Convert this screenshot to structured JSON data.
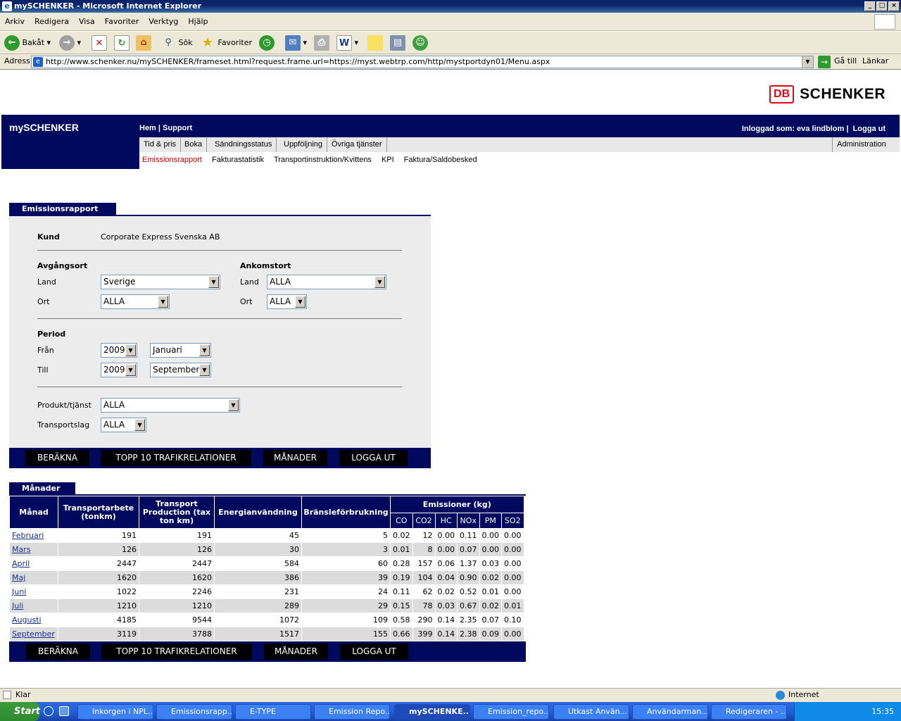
{
  "window": {
    "title": "mySCHENKER - Microsoft Internet Explorer"
  },
  "menu": [
    "Arkiv",
    "Redigera",
    "Visa",
    "Favoriter",
    "Verktyg",
    "Hjälp"
  ],
  "toolbar": {
    "back": "Bakåt",
    "search": "Sök",
    "favorites": "Favoriter"
  },
  "address": {
    "label": "Adress",
    "url": "http://www.schenker.nu/mySCHENKER/frameset.html?request.frame.url=https://myst.webtrp.com/http/mystportdyn01/Menu.aspx",
    "go": "Gå till",
    "links": "Länkar"
  },
  "header": {
    "logo_db": "DB",
    "logo_text": "SCHENKER",
    "brand": "mySCHENKER",
    "home": "Hem",
    "separator": "|",
    "support": "Support",
    "user_label": "Inloggad som: eva lindblom",
    "logout": "Logga ut"
  },
  "nav": {
    "tabs": [
      "Tid & pris",
      "Boka",
      "Sändningsstatus",
      "Uppföljning",
      "Övriga tjänster"
    ],
    "admin": "Administration",
    "sub": [
      "Emissionsrapport",
      "Fakturastatistik",
      "Transportinstruktion/Kvittens",
      "KPI",
      "Faktura/Saldobesked"
    ]
  },
  "form": {
    "section_title": "Emissionsrapport",
    "kund_label": "Kund",
    "kund_value": "Corporate Express Svenska AB",
    "avgang_title": "Avgångsort",
    "ankomst_title": "Ankomstort",
    "land_label": "Land",
    "ort_label": "Ort",
    "avgang_land": "Sverige",
    "avgang_ort": "ALLA",
    "ankomst_land": "ALLA",
    "ankomst_ort": "ALLA",
    "period_title": "Period",
    "fran_label": "Från",
    "till_label": "Till",
    "fran_year": "2009",
    "fran_month": "Januari",
    "till_year": "2009",
    "till_month": "September",
    "produkt_label": "Produkt/tjänst",
    "produkt_value": "ALLA",
    "transportslag_label": "Transportslag",
    "transportslag_value": "ALLA"
  },
  "buttons": {
    "calc": "BERÄKNA",
    "top10": "TOPP 10 TRAFIKRELATIONER",
    "months": "MÅNADER",
    "logout": "LOGGA UT"
  },
  "table": {
    "section_title": "Månader",
    "headers": {
      "month": "Månad",
      "transportarbete": "Transportarbete (tonkm)",
      "production": "Transport Production (tax ton km)",
      "energi": "Energianvändning",
      "bransle": "Bränsleförbrukning",
      "emissioner": "Emissioner (kg)"
    },
    "subheaders": [
      "CO",
      "CO2",
      "HC",
      "NOx",
      "PM",
      "SO2"
    ],
    "rows": [
      [
        "Februari",
        "191",
        "191",
        "45",
        "5",
        "0.02",
        "12",
        "0.00",
        "0.11",
        "0.00",
        "0.00"
      ],
      [
        "Mars",
        "126",
        "126",
        "30",
        "3",
        "0.01",
        "8",
        "0.00",
        "0.07",
        "0.00",
        "0.00"
      ],
      [
        "April",
        "2447",
        "2447",
        "584",
        "60",
        "0.28",
        "157",
        "0.06",
        "1.37",
        "0.03",
        "0.00"
      ],
      [
        "Maj",
        "1620",
        "1620",
        "386",
        "39",
        "0.19",
        "104",
        "0.04",
        "0.90",
        "0.02",
        "0.00"
      ],
      [
        "Juni",
        "1022",
        "2246",
        "231",
        "24",
        "0.11",
        "62",
        "0.02",
        "0.52",
        "0.01",
        "0.00"
      ],
      [
        "Juli",
        "1210",
        "1210",
        "289",
        "29",
        "0.15",
        "78",
        "0.03",
        "0.67",
        "0.02",
        "0.01"
      ],
      [
        "Augusti",
        "4185",
        "9544",
        "1072",
        "109",
        "0.58",
        "290",
        "0.14",
        "2.35",
        "0.07",
        "0.10"
      ],
      [
        "September",
        "3119",
        "3788",
        "1517",
        "155",
        "0.66",
        "399",
        "0.14",
        "2.38",
        "0.09",
        "0.00"
      ]
    ]
  },
  "status": {
    "text": "Klar",
    "zone": "Internet"
  },
  "taskbar": {
    "start": "Start",
    "tasks": [
      "Inkorgen i NPL...",
      "Emissionsrapp...",
      "E-TYPE",
      "Emission Repo...",
      "mySCHENKE...",
      "Emission_repo...",
      "Utkast Använ...",
      "Användarman...",
      "Redigeraren - ..."
    ],
    "clock": "15:35"
  },
  "colors": {
    "navy": "#00095e",
    "db_red": "#e30613",
    "link_active": "#c00000"
  }
}
